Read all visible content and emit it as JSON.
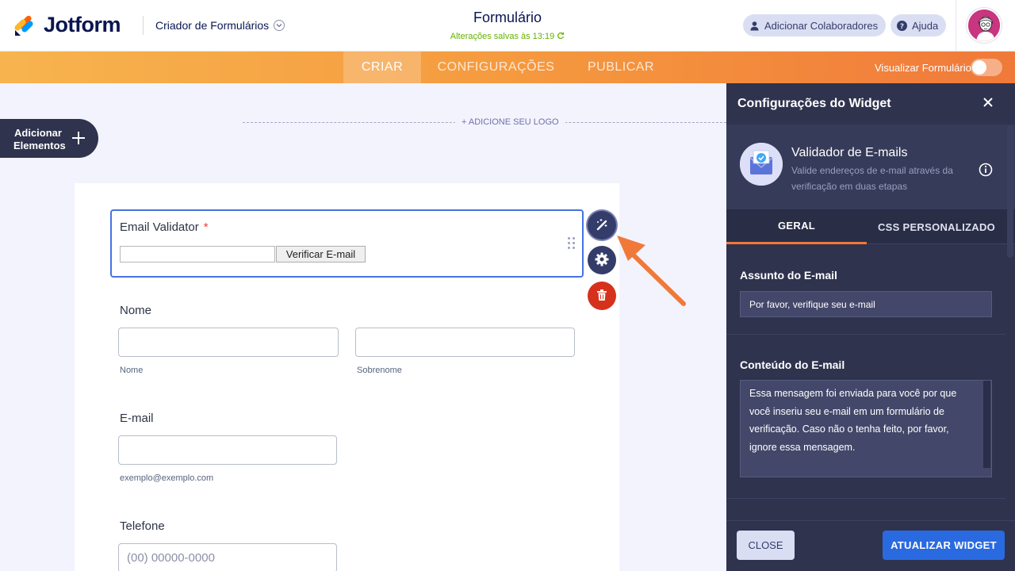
{
  "header": {
    "brand": "Jotform",
    "builder_menu": "Criador de Formulários",
    "form_title": "Formulário",
    "saved_status": "Alterações salvas às 13:19",
    "add_collaborators": "Adicionar Colaboradores",
    "help": "Ajuda"
  },
  "nav": {
    "tabs": [
      {
        "label": "CRIAR",
        "active": true
      },
      {
        "label": "CONFIGURAÇÕES",
        "active": false
      },
      {
        "label": "PUBLICAR",
        "active": false
      }
    ],
    "preview_label": "Visualizar Formulário",
    "preview_on": false
  },
  "canvas": {
    "add_elements_label": "Adicionar Elementos",
    "add_logo": "+ ADICIONE SEU LOGO",
    "email_validator": {
      "label": "Email Validator",
      "required_mark": "*",
      "verify_button": "Verificar E-mail"
    },
    "name_field": {
      "label": "Nome",
      "first_sublabel": "Nome",
      "last_sublabel": "Sobrenome"
    },
    "email_field": {
      "label": "E-mail",
      "sublabel": "exemplo@exemplo.com"
    },
    "phone_field": {
      "label": "Telefone",
      "placeholder": "(00) 00000-0000"
    }
  },
  "panel": {
    "title": "Configurações do Widget",
    "widget_name": "Validador de E-mails",
    "widget_description": "Valide endereços de e-mail através da verificação em duas etapas",
    "tabs": [
      {
        "label": "GERAL",
        "active": true
      },
      {
        "label": "CSS PERSONALIZADO",
        "active": false
      }
    ],
    "subject_label": "Assunto do E-mail",
    "subject_value": "Por favor, verifique seu e-mail",
    "content_label": "Conteúdo do E-mail",
    "content_value": "Essa mensagem foi enviada para você por que você inseriu seu e-mail em um formulário de verificação. Caso não o tenha feito, por favor, ignore essa mensagem.",
    "close_button": "CLOSE",
    "update_button": "ATUALIZAR WIDGET"
  },
  "colors": {
    "brand_orange": "#f0793a",
    "primary_blue": "#2a6ae0",
    "panel_bg": "#2f334e",
    "saved_green": "#64b200"
  }
}
